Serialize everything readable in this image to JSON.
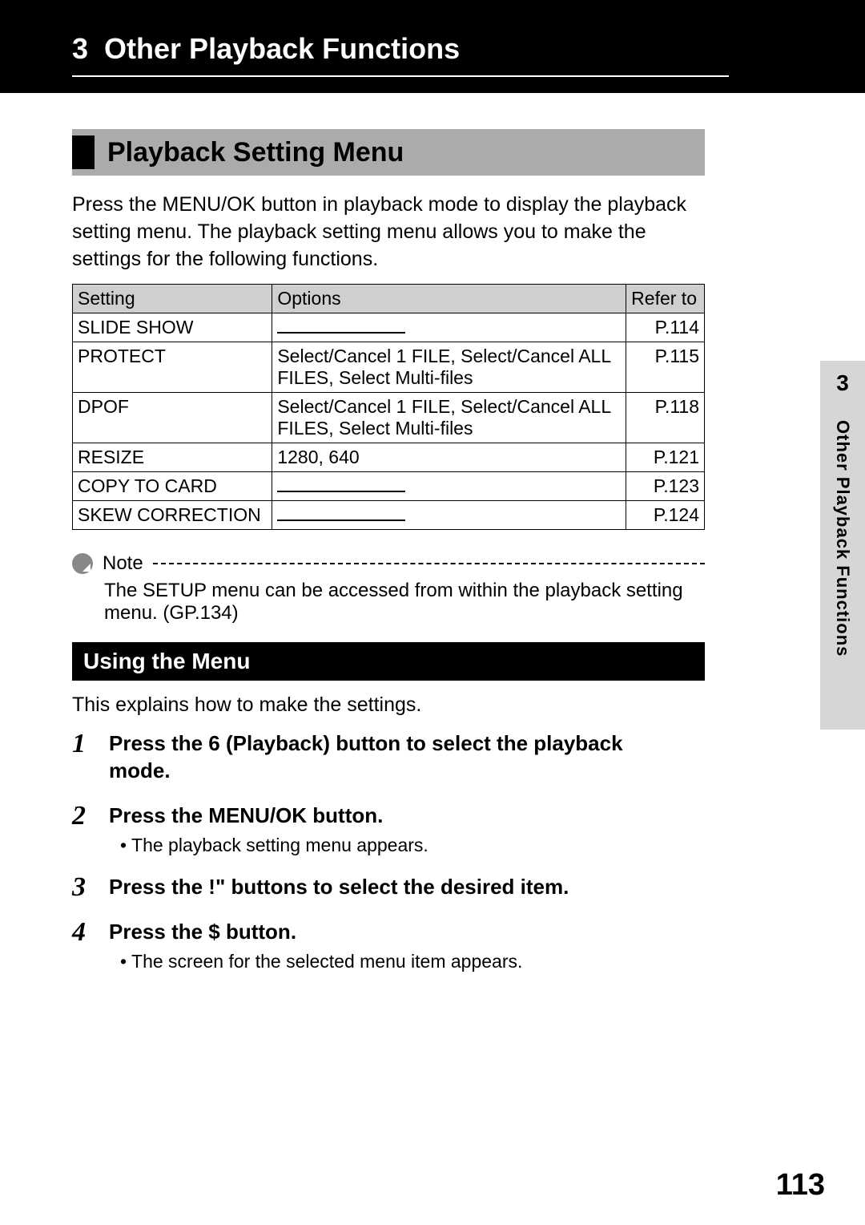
{
  "header": {
    "chapter_number": "3",
    "chapter_title": "Other Playback Functions"
  },
  "section": {
    "title": "Playback Setting Menu",
    "intro": "Press the MENU/OK button in playback mode to display the playback setting menu. The playback setting menu allows you to make the settings for the following functions."
  },
  "table": {
    "headers": {
      "setting": "Setting",
      "options": "Options",
      "refer": "Refer to"
    },
    "rows": [
      {
        "setting": "SLIDE SHOW",
        "options": "",
        "dash": true,
        "refer": "P.114"
      },
      {
        "setting": "PROTECT",
        "options": "Select/Cancel 1 FILE, Select/Cancel ALL FILES, Select Multi-files",
        "refer": "P.115"
      },
      {
        "setting": "DPOF",
        "options": "Select/Cancel 1 FILE, Select/Cancel ALL FILES, Select Multi-files",
        "refer": "P.118"
      },
      {
        "setting": "RESIZE",
        "options": "1280, 640",
        "refer": "P.121"
      },
      {
        "setting": "COPY TO CARD",
        "options": "",
        "dash": true,
        "refer": "P.123"
      },
      {
        "setting": "SKEW CORRECTION",
        "options": "",
        "dash": true,
        "refer": "P.124"
      }
    ]
  },
  "note": {
    "label": "Note",
    "text": "The SETUP menu can be accessed from within the playback setting menu. (GP.134)"
  },
  "sub_section": {
    "title": "Using the Menu",
    "intro": "This explains how to make the settings."
  },
  "steps": [
    {
      "num": "1",
      "text": "Press the 6 (Playback) button to select the playback mode.",
      "sub": ""
    },
    {
      "num": "2",
      "text": "Press the MENU/OK button.",
      "sub": "The playback setting menu appears."
    },
    {
      "num": "3",
      "text": "Press the !\" buttons to select the desired item.",
      "sub": ""
    },
    {
      "num": "4",
      "text": "Press the $ button.",
      "sub": "The screen for the selected menu item appears."
    }
  ],
  "side_tab": {
    "number": "3",
    "text": "Other Playback Functions"
  },
  "page_number": "113",
  "chart_data": {
    "type": "table",
    "title": "Playback Setting Menu options",
    "columns": [
      "Setting",
      "Options",
      "Refer to"
    ],
    "rows": [
      [
        "SLIDE SHOW",
        "—",
        "P.114"
      ],
      [
        "PROTECT",
        "Select/Cancel 1 FILE, Select/Cancel ALL FILES, Select Multi-files",
        "P.115"
      ],
      [
        "DPOF",
        "Select/Cancel 1 FILE, Select/Cancel ALL FILES, Select Multi-files",
        "P.118"
      ],
      [
        "RESIZE",
        "1280, 640",
        "P.121"
      ],
      [
        "COPY TO CARD",
        "—",
        "P.123"
      ],
      [
        "SKEW CORRECTION",
        "—",
        "P.124"
      ]
    ]
  }
}
